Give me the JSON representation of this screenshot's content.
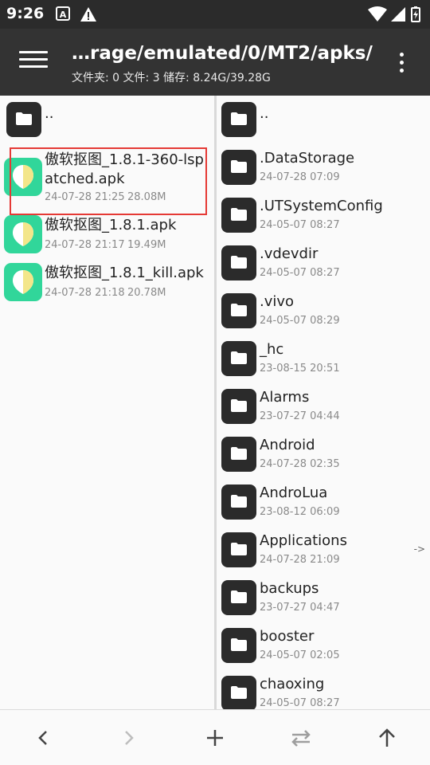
{
  "status_bar": {
    "time": "9:26",
    "icons": [
      "a-notification-icon",
      "warning-icon",
      "wifi-icon",
      "signal-icon",
      "battery-charging-icon"
    ]
  },
  "toolbar": {
    "path": "…rage/emulated/0/MT2/apks/",
    "stats": "文件夹: 0  文件: 3  储存: 8.24G/39.28G"
  },
  "left_pane": {
    "parent_label": "..",
    "files": [
      {
        "name_line1": "傲软抠图_1.8.1-360-lsp",
        "name_line2": "atched.apk",
        "date": "24-07-28 21:25",
        "size": "28.08M",
        "highlighted": true
      },
      {
        "name_line1": "傲软抠图_1.8.1.apk",
        "name_line2": "",
        "date": "24-07-28 21:17",
        "size": "19.49M"
      },
      {
        "name_line1": "傲软抠图_1.8.1_kill.apk",
        "name_line2": "",
        "date": "24-07-28 21:18",
        "size": "20.78M"
      }
    ]
  },
  "right_pane": {
    "parent_label": "..",
    "folders": [
      {
        "name": ".DataStorage",
        "date": "24-07-28 07:09",
        "arrow": ""
      },
      {
        "name": ".UTSystemConfig",
        "date": "24-05-07 08:27",
        "arrow": ""
      },
      {
        "name": ".vdevdir",
        "date": "24-05-07 08:27",
        "arrow": ""
      },
      {
        "name": ".vivo",
        "date": "24-05-07 08:29",
        "arrow": ""
      },
      {
        "name": "_hc",
        "date": "23-08-15 20:51",
        "arrow": ""
      },
      {
        "name": "Alarms",
        "date": "23-07-27 04:44",
        "arrow": ""
      },
      {
        "name": "Android",
        "date": "24-07-28 02:35",
        "arrow": ""
      },
      {
        "name": "AndroLua",
        "date": "23-08-12 06:09",
        "arrow": ""
      },
      {
        "name": "Applications",
        "date": "24-07-28 21:09",
        "arrow": "->"
      },
      {
        "name": "backups",
        "date": "23-07-27 04:47",
        "arrow": ""
      },
      {
        "name": "booster",
        "date": "24-05-07 02:05",
        "arrow": ""
      },
      {
        "name": "chaoxing",
        "date": "24-05-07 08:27",
        "arrow": ""
      }
    ]
  },
  "bottom_bar": {
    "buttons": [
      "back-icon",
      "forward-icon",
      "add-icon",
      "swap-icon",
      "up-icon"
    ]
  },
  "colors": {
    "toolbar": "#333333",
    "statusbar": "#2b2b2b",
    "apk_icon": "#31d69a",
    "highlight": "#e53935"
  }
}
